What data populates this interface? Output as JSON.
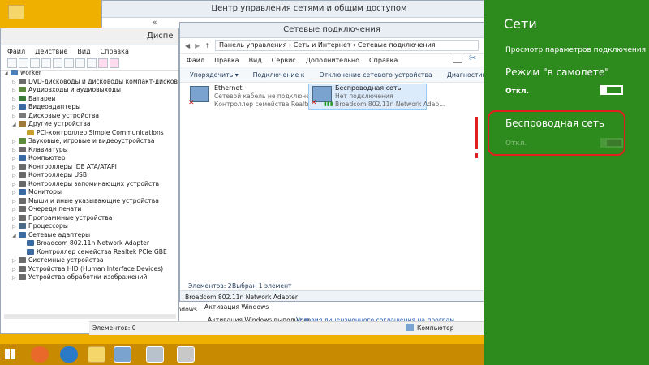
{
  "desktop": {
    "help_icon_label": "help"
  },
  "back_window": {
    "title": "Центр управления сетями и общим доступом",
    "nav_text": "«",
    "link_update": "Центр обновления Windows",
    "activation_title": "Активация Windows",
    "activation_done": "Активация Windows выполнена",
    "license_link": "Условия лицензионного соглашения на програм"
  },
  "device_manager": {
    "title": "Диспе",
    "menu": [
      "Файл",
      "Действие",
      "Вид",
      "Справка"
    ],
    "status": "Элементов: 0",
    "computer_status": "Компьютер",
    "tree": [
      {
        "label": "worker",
        "level": 0,
        "exp": "◢",
        "color": "#4a7fb8"
      },
      {
        "label": "DVD-дисководы и дисководы компакт-дисков",
        "level": 1,
        "exp": "▷",
        "color": "#6c6c6c"
      },
      {
        "label": "Аудиовходы и аудиовыходы",
        "level": 1,
        "exp": "▷",
        "color": "#5a8a3a"
      },
      {
        "label": "Батареи",
        "level": 1,
        "exp": "▷",
        "color": "#3a7a3a"
      },
      {
        "label": "Видеоадаптеры",
        "level": 1,
        "exp": "▷",
        "color": "#3a6aa0"
      },
      {
        "label": "Дисковые устройства",
        "level": 1,
        "exp": "▷",
        "color": "#7a7a7a"
      },
      {
        "label": "Другие устройства",
        "level": 1,
        "exp": "◢",
        "color": "#a07a3a"
      },
      {
        "label": "PCI-контроллер Simple Communications",
        "level": 2,
        "exp": "",
        "color": "#c8a030"
      },
      {
        "label": "Звуковые, игровые и видеоустройства",
        "level": 1,
        "exp": "▷",
        "color": "#5a8a3a"
      },
      {
        "label": "Клавиатуры",
        "level": 1,
        "exp": "▷",
        "color": "#6a6a6a"
      },
      {
        "label": "Компьютер",
        "level": 1,
        "exp": "▷",
        "color": "#3a6aa0"
      },
      {
        "label": "Контроллеры IDE ATA/ATAPI",
        "level": 1,
        "exp": "▷",
        "color": "#6a6a6a"
      },
      {
        "label": "Контроллеры USB",
        "level": 1,
        "exp": "▷",
        "color": "#6a6a6a"
      },
      {
        "label": "Контроллеры запоминающих устройств",
        "level": 1,
        "exp": "▷",
        "color": "#6a6a6a"
      },
      {
        "label": "Мониторы",
        "level": 1,
        "exp": "▷",
        "color": "#3a6aa0"
      },
      {
        "label": "Мыши и иные указывающие устройства",
        "level": 1,
        "exp": "▷",
        "color": "#6a6a6a"
      },
      {
        "label": "Очереди печати",
        "level": 1,
        "exp": "▷",
        "color": "#6a6a6a"
      },
      {
        "label": "Программные устройства",
        "level": 1,
        "exp": "▷",
        "color": "#6a6a6a"
      },
      {
        "label": "Процессоры",
        "level": 1,
        "exp": "▷",
        "color": "#4a6a8a"
      },
      {
        "label": "Сетевые адаптеры",
        "level": 1,
        "exp": "◢",
        "color": "#3a6aa0"
      },
      {
        "label": "Broadcom 802.11n Network Adapter",
        "level": 2,
        "exp": "",
        "color": "#3a6aa0"
      },
      {
        "label": "Контроллер семейства Realtek PCIe GBE",
        "level": 2,
        "exp": "",
        "color": "#3a6aa0"
      },
      {
        "label": "Системные устройства",
        "level": 1,
        "exp": "▷",
        "color": "#6a6a6a"
      },
      {
        "label": "Устройства HID (Human Interface Devices)",
        "level": 1,
        "exp": "▷",
        "color": "#6a6a6a"
      },
      {
        "label": "Устройства обработки изображений",
        "level": 1,
        "exp": "▷",
        "color": "#6a6a6a"
      }
    ]
  },
  "net_connections": {
    "title": "Сетевые подключения",
    "breadcrumb": [
      "Панель управления",
      "Сеть и Интернет",
      "Сетевые подключения"
    ],
    "menu": [
      "Файл",
      "Правка",
      "Вид",
      "Сервис",
      "Дополнительно",
      "Справка"
    ],
    "commands": [
      "Упорядочить",
      "Подключение к",
      "Отключение сетевого устройства",
      "Диагностика подключения"
    ],
    "items": [
      {
        "name": "Ethernet",
        "status": "Сетевой кабель не подключен",
        "device": "Контроллер семейства Realtek P..."
      },
      {
        "name": "Беспроводная сеть",
        "status": "Нет подключения",
        "device": "Broadcom 802.11n Network Adap..."
      }
    ],
    "status_count": "Элементов: 2",
    "status_selected": "Выбран 1 элемент",
    "details": "Broadcom 802.11n Network Adapter"
  },
  "charm": {
    "title": "Сети",
    "view_link": "Просмотр параметров подключения",
    "airplane_label": "Режим \"в самолете\"",
    "airplane_state": "Откл.",
    "wireless_label": "Беспроводная сеть",
    "wireless_state": "Откл.",
    "bg_color": "#2d8a1d",
    "highlight_color": "#e02020"
  }
}
